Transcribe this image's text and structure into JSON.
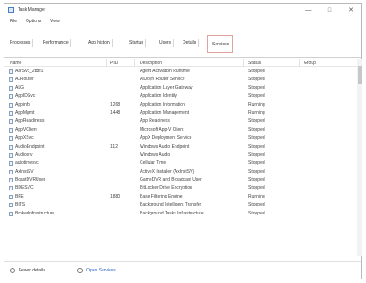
{
  "window": {
    "title": "Task Manager",
    "buttons": {
      "minimize": "—",
      "maximize": "□",
      "close": "✕"
    },
    "icon": "task-manager-icon"
  },
  "menu": {
    "items": [
      "File",
      "Options",
      "View"
    ]
  },
  "tabs": [
    {
      "label": "Processes",
      "active": false
    },
    {
      "label": "Performance",
      "active": false
    },
    {
      "label": "App history",
      "active": false
    },
    {
      "label": "Startup",
      "active": false
    },
    {
      "label": "Users",
      "active": false
    },
    {
      "label": "Details",
      "active": false
    },
    {
      "label": "Services",
      "active": true
    }
  ],
  "table": {
    "headers": {
      "name": "Name",
      "pid": "PID",
      "description": "Description",
      "status": "Status",
      "group": "Group"
    },
    "rows": [
      {
        "name": "AarSvc_2b8f1",
        "pid": "",
        "description": "Agent Activation Runtime",
        "status": "Stopped",
        "group": ""
      },
      {
        "name": "AJRouter",
        "pid": "",
        "description": "AllJoyn Router Service",
        "status": "Stopped",
        "group": ""
      },
      {
        "name": "ALG",
        "pid": "",
        "description": "Application Layer Gateway",
        "status": "Stopped",
        "group": ""
      },
      {
        "name": "AppIDSvc",
        "pid": "",
        "description": "Application Identity",
        "status": "Stopped",
        "group": ""
      },
      {
        "name": "Appinfo",
        "pid": "1268",
        "description": "Application Information",
        "status": "Running",
        "group": ""
      },
      {
        "name": "AppMgmt",
        "pid": "1448",
        "description": "Application Management",
        "status": "Running",
        "group": ""
      },
      {
        "name": "AppReadiness",
        "pid": "",
        "description": "App Readiness",
        "status": "Stopped",
        "group": ""
      },
      {
        "name": "AppVClient",
        "pid": "",
        "description": "Microsoft App-V Client",
        "status": "Stopped",
        "group": ""
      },
      {
        "name": "AppXSvc",
        "pid": "",
        "description": "AppX Deployment Service",
        "status": "Stopped",
        "group": ""
      },
      {
        "name": "AudioEndpoint",
        "pid": "112",
        "description": "Windows Audio Endpoint",
        "status": "Stopped",
        "group": ""
      },
      {
        "name": "Audiosrv",
        "pid": "",
        "description": "Windows Audio",
        "status": "Stopped",
        "group": ""
      },
      {
        "name": "autotimesvc",
        "pid": "",
        "description": "Cellular Time",
        "status": "Stopped",
        "group": ""
      },
      {
        "name": "AxInstSV",
        "pid": "",
        "description": "ActiveX Installer (AxInstSV)",
        "status": "Stopped",
        "group": ""
      },
      {
        "name": "BcastDVRUser",
        "pid": "",
        "description": "GameDVR and Broadcast User",
        "status": "Stopped",
        "group": ""
      },
      {
        "name": "BDESVC",
        "pid": "",
        "description": "BitLocker Drive Encryption",
        "status": "Stopped",
        "group": ""
      },
      {
        "name": "BFE",
        "pid": "1880",
        "description": "Base Filtering Engine",
        "status": "Running",
        "group": ""
      },
      {
        "name": "BITS",
        "pid": "",
        "description": "Background Intelligent Transfer",
        "status": "Stopped",
        "group": ""
      },
      {
        "name": "BrokerInfrastructure",
        "pid": "",
        "description": "Background Tasks Infrastructure",
        "status": "Stopped",
        "group": ""
      }
    ]
  },
  "footer": {
    "fewer_details": "Fewer details",
    "open_services": "Open Services"
  },
  "colors": {
    "active_tab_border": "#e0a1a1",
    "link": "#2b63c8"
  }
}
